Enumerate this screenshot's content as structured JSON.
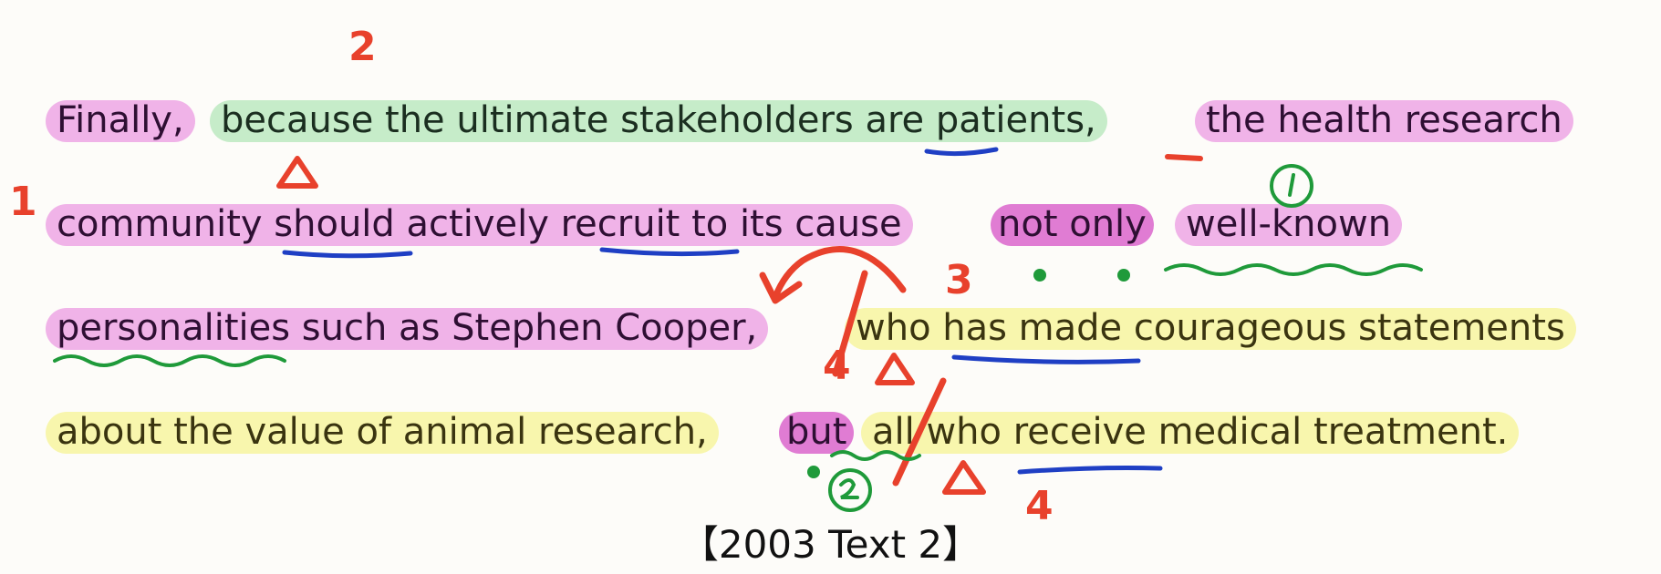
{
  "passage": {
    "line1": {
      "s1": "Finally,",
      "s2": "because the ultimate stakeholders are patients,",
      "s3": "the health research"
    },
    "line2": {
      "s1": "community should actively recruit to its cause",
      "s2": "not only",
      "s3": "well-known"
    },
    "line3": {
      "s1": "personalities such as Stephen Cooper,",
      "s2": "who has made courageous statements"
    },
    "line4": {
      "s1": "about the value of animal research,",
      "s2": "but",
      "s3": "all who receive medical treatment."
    }
  },
  "source": "【2003  Text 2】",
  "annotations": {
    "numbers": {
      "n1": "1",
      "n2": "2",
      "n3": "3",
      "n4": "4",
      "n4b": "4"
    },
    "marker_colors": {
      "red": "#e8412c",
      "blue": "#1f3fc4",
      "green": "#1f9a3a"
    }
  },
  "highlight_colors": {
    "main_clause": "#f0b3e8",
    "adverbial_clause": "#c6ecc9",
    "attributive_clause": "#f8f6ad",
    "conjunction": "#e07cd3"
  }
}
